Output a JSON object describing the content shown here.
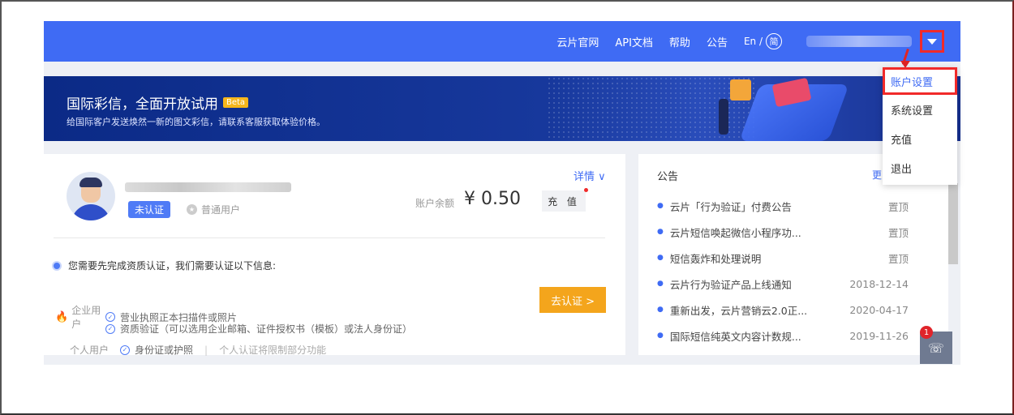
{
  "nav": {
    "items": [
      "云片官网",
      "API文档",
      "帮助",
      "公告"
    ],
    "lang_en": "En /",
    "lang_zh": "简"
  },
  "banner": {
    "title": "国际彩信，全面开放试用",
    "badge": "Beta",
    "subtitle": "给国际客户发送焕然一新的图文彩信，请联系客服获取体验价格。"
  },
  "account": {
    "status_badge": "未认证",
    "user_type": "普通用户",
    "details_link": "详情 ∨",
    "balance_label": "账户余额",
    "balance_value": "¥ 0.50",
    "recharge_label": "充 值"
  },
  "verification": {
    "notice": "您需要先完成资质认证，我们需要认证以下信息:",
    "enterprise_label": "企业用户",
    "enterprise_req_1": "营业执照正本扫描件或照片",
    "enterprise_req_2": "资质验证（可以选用企业邮箱、证件授权书（模板）或法人身份证）",
    "personal_label": "个人用户",
    "personal_req": "身份证或护照",
    "personal_note": "个人认证将限制部分功能",
    "button_label": "去认证 >"
  },
  "announcements": {
    "title": "公告",
    "more": "更",
    "items": [
      {
        "text": "云片「行为验证」付费公告",
        "date": "置顶"
      },
      {
        "text": "云片短信唤起微信小程序功...",
        "date": "置顶"
      },
      {
        "text": "短信轰炸和处理说明",
        "date": "置顶"
      },
      {
        "text": "云片行为验证产品上线通知",
        "date": "2018-12-14"
      },
      {
        "text": "重新出发，云片营销云2.0正...",
        "date": "2020-04-17"
      },
      {
        "text": "国际短信纯英文内容计数规...",
        "date": "2019-11-26"
      }
    ]
  },
  "dropdown": {
    "items": [
      "账户设置",
      "系统设置",
      "充值",
      "退出"
    ]
  },
  "fab": {
    "badge": "1"
  },
  "colors": {
    "primary": "#3f6bf4",
    "warning": "#f4a51c",
    "annotation_red": "#f12a2a"
  }
}
